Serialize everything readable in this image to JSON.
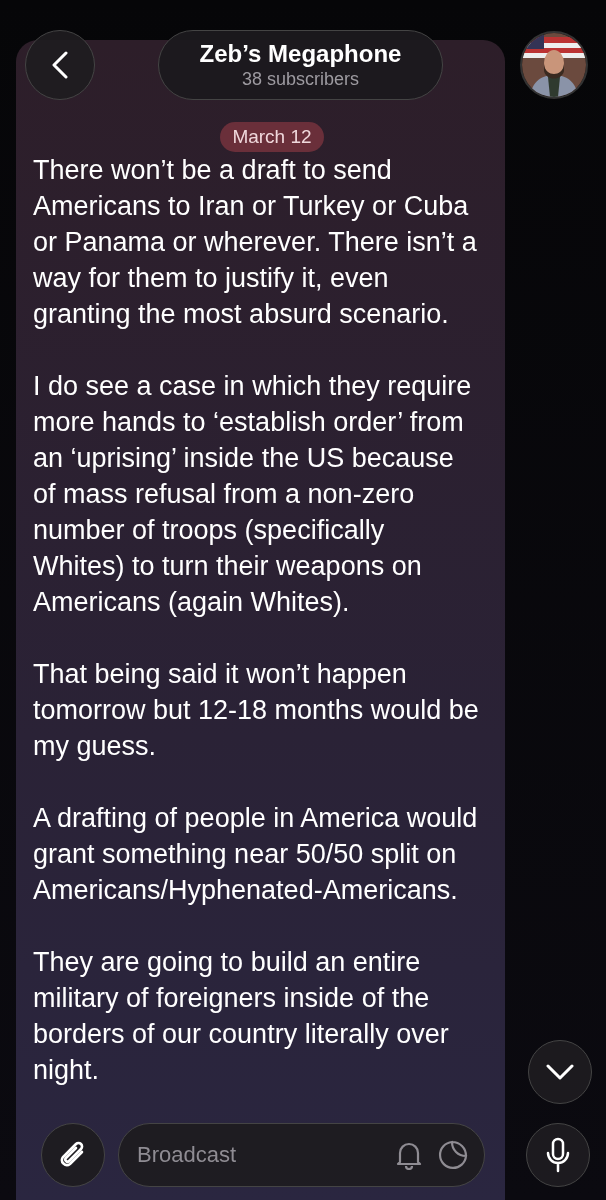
{
  "header": {
    "title": "Zeb’s Megaphone",
    "subtitle": "38 subscribers"
  },
  "message": {
    "date": "March 12",
    "paragraphs": [
      "There won’t be a draft to send Americans to Iran or Turkey or Cuba or Panama or wherever. There isn’t a way for them to justify it, even granting the most absurd scenario.",
      "I do see a case in which they require more hands to ‘establish order’ from an ‘uprising’ inside the US because of mass refusal from a non-zero number of troops (specifically Whites) to turn their weapons on Americans (again Whites).",
      "That being said it won’t happen tomorrow but 12-18 months would be my guess.",
      "A drafting of people in America would grant something near 50/50 split on Americans/Hyphenated-Americans.",
      "They are going to build an entire military of foreigners inside of the borders of our country literally over night."
    ]
  },
  "composer": {
    "placeholder": "Broadcast"
  }
}
